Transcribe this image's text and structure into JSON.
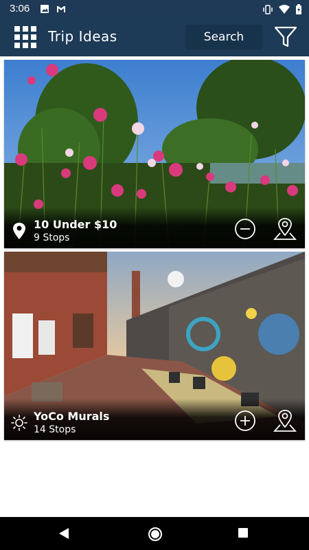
{
  "status_bar": {
    "time": "3:06",
    "left_icons": [
      "image-icon",
      "gmail-icon"
    ],
    "right_icons": [
      "vibrate-icon",
      "wifi-icon",
      "battery-icon"
    ]
  },
  "app_bar": {
    "title": "Trip Ideas",
    "search_label": "Search",
    "menu_icon": "grid-menu-icon",
    "filter_icon": "filter-icon"
  },
  "cards": [
    {
      "title": "10 Under $10",
      "subtitle": "9 Stops",
      "lead_icon": "location-pin-icon",
      "action_icon": "minus-circle-icon",
      "map_icon": "map-pin-icon"
    },
    {
      "title": "YoCo Murals",
      "subtitle": "14 Stops",
      "lead_icon": "sun-icon",
      "action_icon": "plus-circle-icon",
      "map_icon": "map-pin-icon"
    }
  ],
  "colors": {
    "app_bar": "#1d3a56",
    "status_bar": "#1f3a57",
    "search_button": "#17324b"
  },
  "nav_bar": {
    "icons": [
      "back-icon",
      "home-icon",
      "recents-icon"
    ]
  }
}
